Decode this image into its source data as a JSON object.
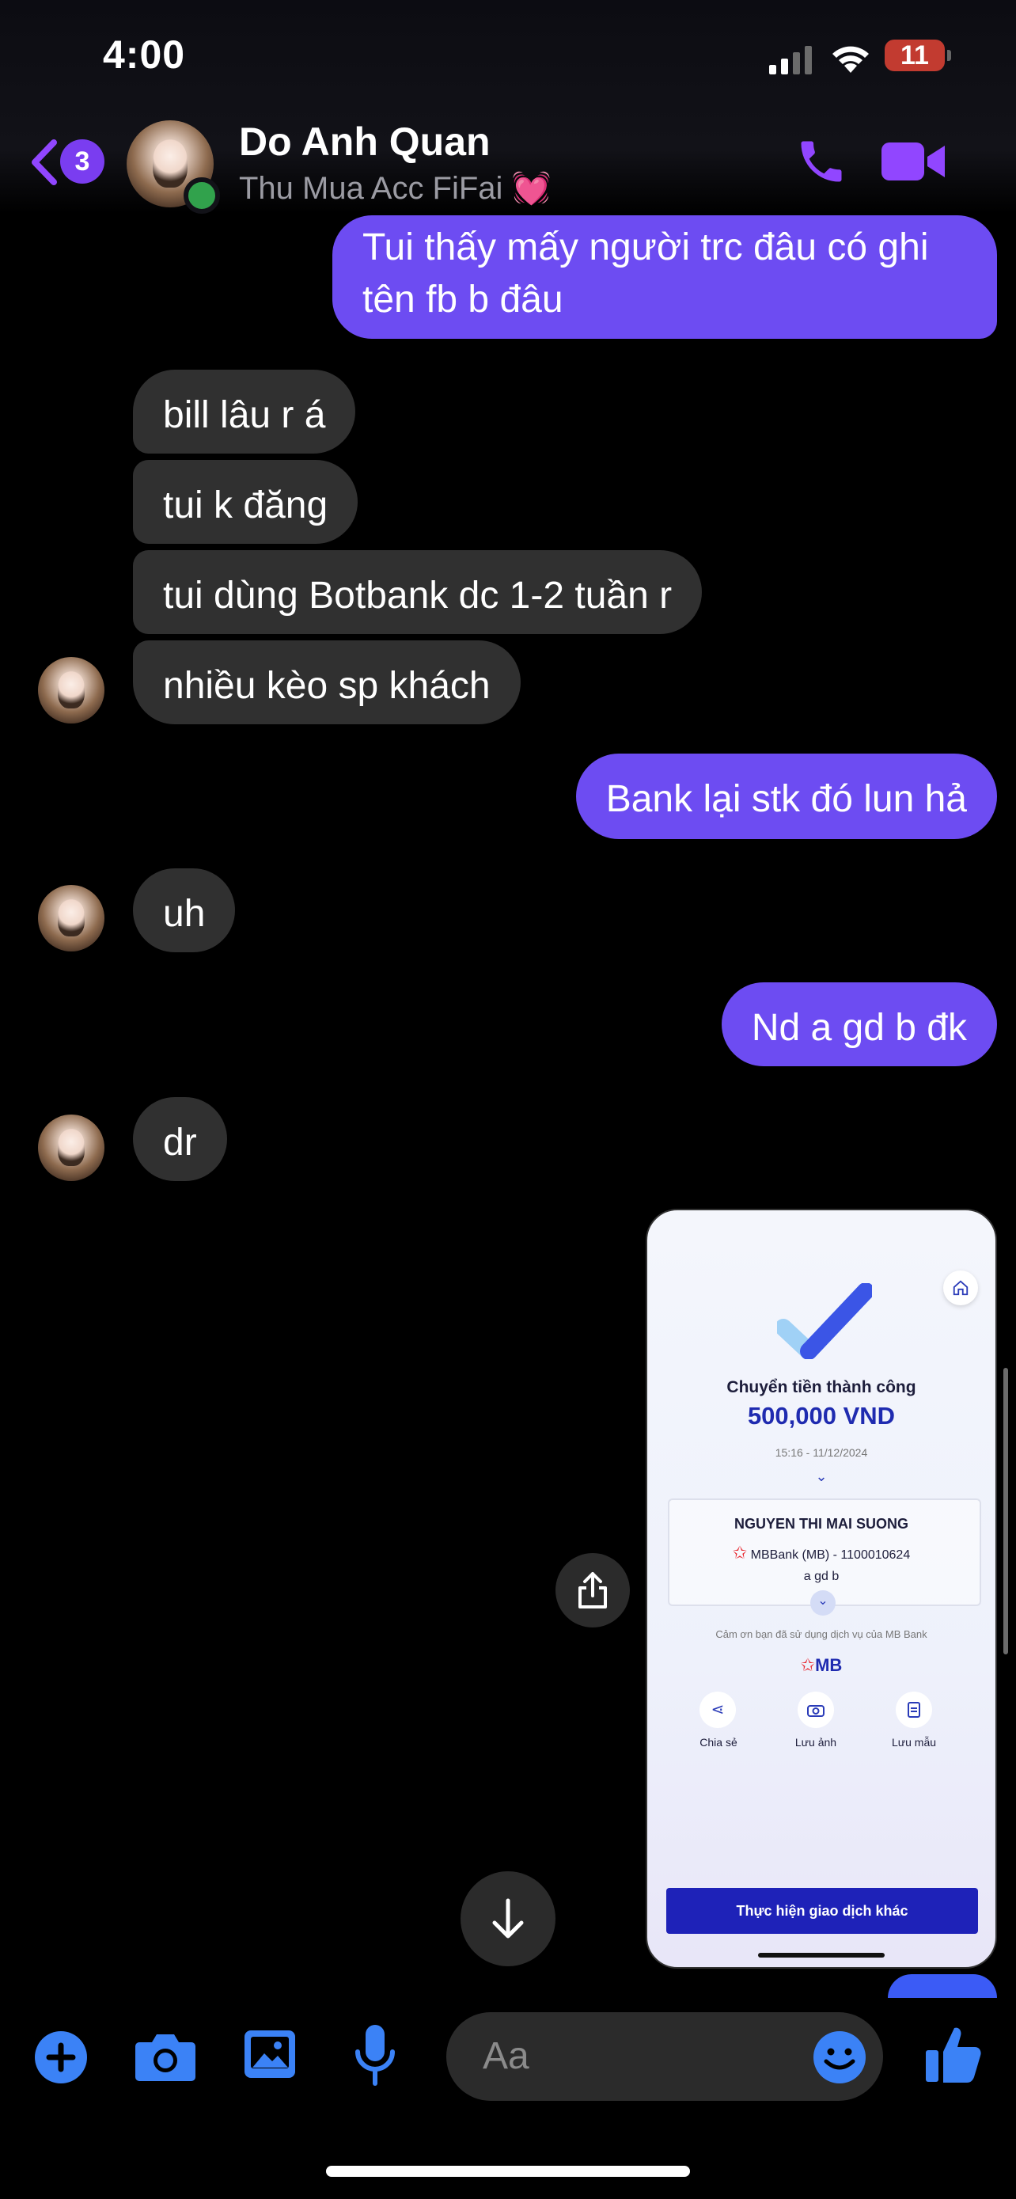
{
  "status_bar": {
    "time": "4:00",
    "battery": "11"
  },
  "header": {
    "unread_count": "3",
    "contact_name": "Do Anh Quan",
    "contact_subtitle": "Thu Mua Acc FiFai 💓",
    "colors": {
      "accent": "#9146ff",
      "online": "#31a24c"
    }
  },
  "messages": [
    {
      "dir": "out",
      "text_lines": [
        "Tui thấy mấy người trc đâu có ghi",
        "tên fb b đâu"
      ]
    },
    {
      "dir": "in",
      "text": "bill lâu r á"
    },
    {
      "dir": "in",
      "text": "tui k đăng"
    },
    {
      "dir": "in",
      "text": "tui dùng Botbank dc 1-2 tuần r"
    },
    {
      "dir": "in",
      "text": "nhiều kèo sp khách"
    },
    {
      "dir": "out",
      "text": "Bank lại stk đó lun hả"
    },
    {
      "dir": "in",
      "text": "uh"
    },
    {
      "dir": "out",
      "text": "Nd a gd b đk"
    },
    {
      "dir": "in",
      "text": "dr"
    }
  ],
  "receipt": {
    "title": "Chuyển tiền thành công",
    "amount": "500,000 VND",
    "datetime": "15:16 - 11/12/2024",
    "recipient_name": "NGUYEN THI MAI SUONG",
    "bank_account": "MBBank (MB) - 1100010624",
    "note": "a gd b",
    "thanks": "Cảm ơn bạn đã sử dụng dịch vụ của MB Bank",
    "brand": "MB",
    "actions": [
      "Chia sẻ",
      "Lưu ảnh",
      "Lưu mẫu"
    ],
    "cta": "Thực hiện giao dịch khác",
    "colors": {
      "amount": "#1f2bb0",
      "cta": "#1e22b8",
      "brand_red": "#e8262e"
    }
  },
  "composer": {
    "placeholder": "Aa"
  },
  "colors": {
    "outgoing": "#6d4cf2",
    "incoming": "#303030",
    "icons": "#3b82f6"
  }
}
